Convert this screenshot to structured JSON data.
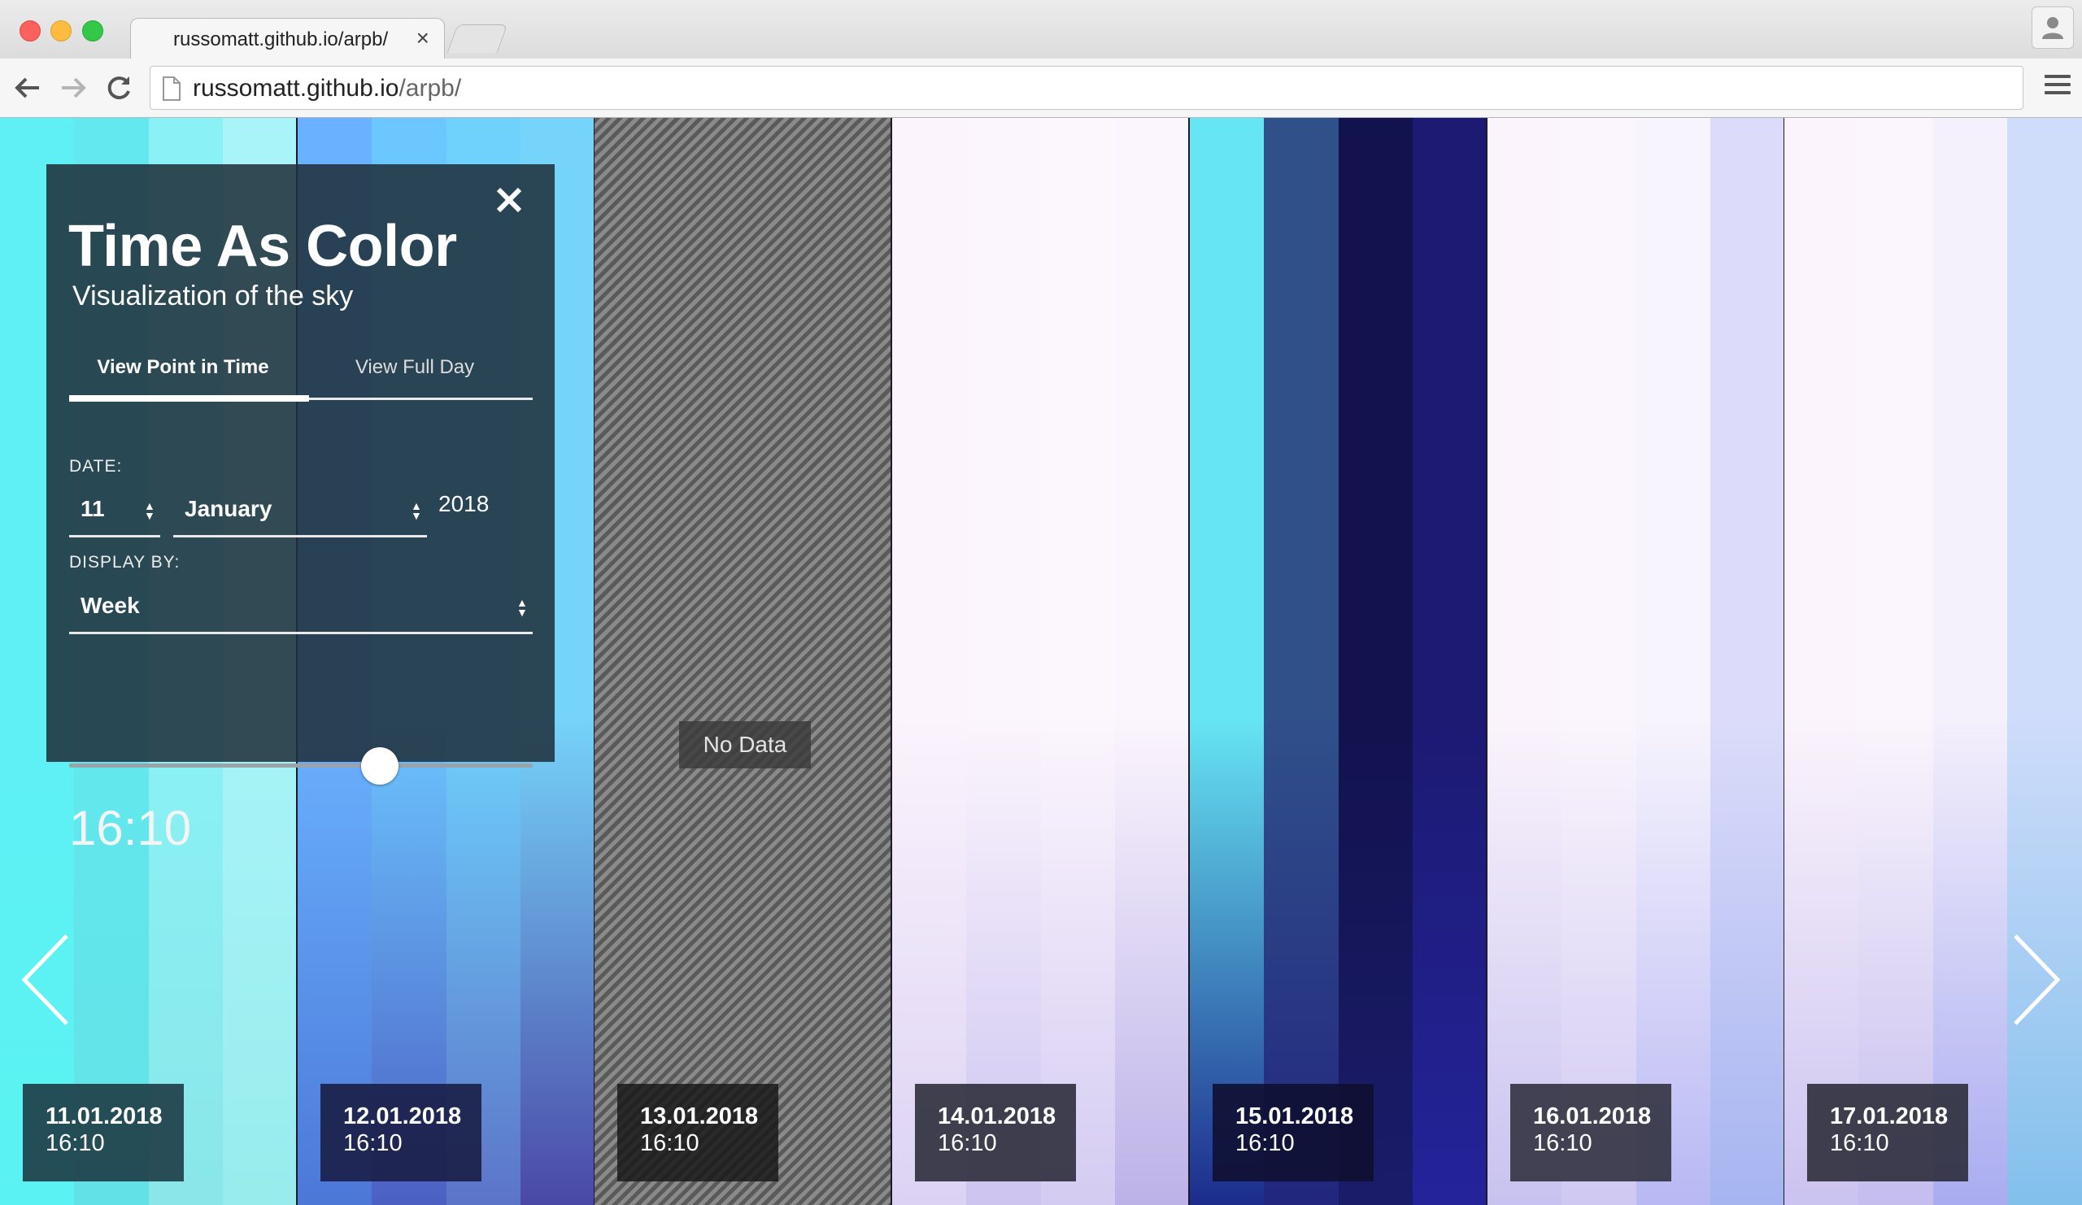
{
  "browser": {
    "tab_title": "russomatt.github.io/arpb/",
    "tab_close": "×",
    "url_host": "russomatt.github.io",
    "url_path": "/arpb/"
  },
  "panel": {
    "title": "Time As Color",
    "subtitle": "Visualization of the sky",
    "close_label": "×",
    "tabs": [
      {
        "label": "View Point in Time",
        "active": true
      },
      {
        "label": "View Full Day",
        "active": false
      }
    ],
    "date_label": "DATE:",
    "day_value": "11",
    "month_value": "January",
    "year_value": "2018",
    "display_by_label": "DISPLAY BY:",
    "display_by_value": "Week",
    "time": "16:10",
    "slider_position": 0.67
  },
  "days": [
    {
      "date": "11.01.2018",
      "time": "16:10",
      "no_data": false,
      "strips": [
        [
          "#5ef0f4",
          "#5af2f2"
        ],
        [
          "#62e8ee",
          "#62e2e6"
        ],
        [
          "#8af2f6",
          "#8ae6e8"
        ],
        [
          "#a8f4f8",
          "#98ecec"
        ]
      ]
    },
    {
      "date": "12.01.2018",
      "time": "16:10",
      "no_data": false,
      "strips": [
        [
          "#6ab2ff",
          "#4c78d8"
        ],
        [
          "#6cc6ff",
          "#4c60c4"
        ],
        [
          "#6ed2fc",
          "#5c74c8"
        ],
        [
          "#76d4fa",
          "#4a48a6"
        ]
      ]
    },
    {
      "date": "13.01.2018",
      "time": "16:10",
      "no_data": true,
      "no_data_label": "No Data",
      "strips": []
    },
    {
      "date": "14.01.2018",
      "time": "16:10",
      "no_data": false,
      "strips": [
        [
          "#fbf4fc",
          "#dcd2f4"
        ],
        [
          "#fbf5fd",
          "#cdc4f0"
        ],
        [
          "#fcf6fd",
          "#d4cbf2"
        ],
        [
          "#fbf5fd",
          "#bcb2e8"
        ]
      ]
    },
    {
      "date": "15.01.2018",
      "time": "16:10",
      "no_data": false,
      "strips": [
        [
          "#66e6f4",
          "#1c2c8c"
        ],
        [
          "#30508a",
          "#22267e"
        ],
        [
          "#12124e",
          "#1a1c6a"
        ],
        [
          "#1c1a72",
          "#24239a"
        ]
      ]
    },
    {
      "date": "16.01.2018",
      "time": "16:10",
      "no_data": false,
      "strips": [
        [
          "#fbf4fc",
          "#c8c2f0"
        ],
        [
          "#fbf5fd",
          "#cfc8f2"
        ],
        [
          "#f7f4fd",
          "#b8b8f4"
        ],
        [
          "#dcdcfa",
          "#a6b4f0"
        ]
      ]
    },
    {
      "date": "17.01.2018",
      "time": "16:10",
      "no_data": false,
      "strips": [
        [
          "#fbf4fc",
          "#cbc3f0"
        ],
        [
          "#fbf5fd",
          "#c4bdee"
        ],
        [
          "#f4f0fc",
          "#a9acf0"
        ],
        [
          "#cfdcfa",
          "#82c0ec"
        ]
      ]
    }
  ],
  "nav": {
    "prev_icon": "chevron-left-icon",
    "next_icon": "chevron-right-icon"
  }
}
